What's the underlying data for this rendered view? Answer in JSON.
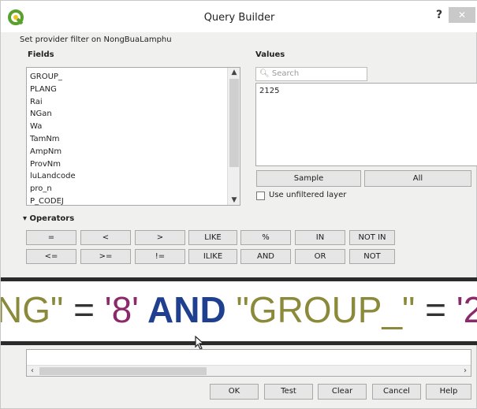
{
  "window": {
    "title": "Query Builder",
    "help_label": "?",
    "close_label": "✕"
  },
  "provider_filter": "Set provider filter on NongBuaLamphu",
  "fields": {
    "label": "Fields",
    "items": [
      "GROUP_",
      "PLANG",
      "Rai",
      "NGan",
      "Wa",
      "TamNm",
      "AmpNm",
      "ProvNm",
      "luLandcode",
      "pro_n",
      "P_CODEJ"
    ]
  },
  "values": {
    "label": "Values",
    "search_placeholder": "Search",
    "items": [
      "2125"
    ],
    "sample_label": "Sample",
    "all_label": "All",
    "unfiltered_label": "Use unfiltered layer"
  },
  "operators": {
    "label": "Operators",
    "row1": [
      "=",
      "<",
      ">",
      "LIKE",
      "%",
      "IN",
      "NOT IN"
    ],
    "row2": [
      "<=",
      ">=",
      "!=",
      "ILIKE",
      "AND",
      "OR",
      "NOT"
    ]
  },
  "expression": {
    "tokens": [
      {
        "text": "NG\"",
        "kind": "field"
      },
      {
        "text": " = ",
        "kind": "op"
      },
      {
        "text": "'8'",
        "kind": "str"
      },
      {
        "text": " AND ",
        "kind": "kw"
      },
      {
        "text": "\"GROUP_\"",
        "kind": "field"
      },
      {
        "text": " = ",
        "kind": "op"
      },
      {
        "text": "'2",
        "kind": "str"
      }
    ]
  },
  "footer": {
    "ok_label": "OK",
    "test_label": "Test",
    "clear_label": "Clear",
    "cancel_label": "Cancel",
    "help_label": "Help"
  },
  "icons": {
    "app": "qgis-logo-icon",
    "cursor": "mouse-pointer-icon"
  },
  "colors": {
    "field": "#8a8a3a",
    "string": "#8a2a6a",
    "keyword": "#1f3f8f",
    "app_icon": "#5aa02c"
  }
}
